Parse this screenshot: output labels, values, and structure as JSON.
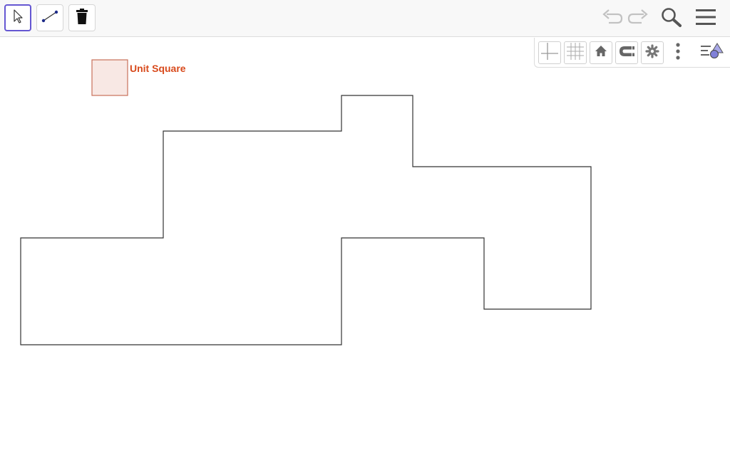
{
  "toolbar": {
    "tools": [
      {
        "id": "move",
        "icon": "cursor-arrow-icon",
        "selected": true
      },
      {
        "id": "segment",
        "icon": "segment-tool-icon",
        "selected": false
      },
      {
        "id": "delete",
        "icon": "trash-icon",
        "selected": false
      }
    ],
    "actions": [
      "undo-icon",
      "redo-icon",
      "search-icon",
      "hamburger-menu-icon"
    ]
  },
  "style_bar": {
    "buttons": [
      "axes-icon",
      "grid-icon",
      "home-icon",
      "magnet-icon",
      "gear-icon",
      "more-vertical-icon",
      "algebra-view-icon"
    ]
  },
  "graphics": {
    "unit_square": {
      "label": "Unit Square",
      "fill_color": "#f8e8e4",
      "stroke_color": "#c8705a",
      "label_color": "#d84a1c"
    },
    "shape_color": "#333333"
  },
  "colors": {
    "selected_tool_border": "#6557d2",
    "point_color": "#1d2b8a"
  }
}
